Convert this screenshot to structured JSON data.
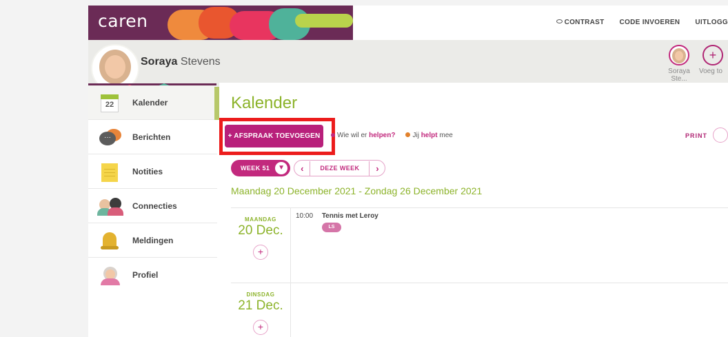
{
  "brand": {
    "name": "caren"
  },
  "top_links": {
    "contrast": "CONTRAST",
    "code": "CODE INVOEREN",
    "logout": "UITLOGG"
  },
  "user": {
    "first_name": "Soraya",
    "last_name": "Stevens"
  },
  "profiles": [
    {
      "label": "Soraya Ste..."
    },
    {
      "label": "Voeg to"
    }
  ],
  "sidebar": {
    "items": [
      {
        "label": "Kalender",
        "icon": "calendar-icon",
        "badge": "22"
      },
      {
        "label": "Berichten",
        "icon": "chat-icon"
      },
      {
        "label": "Notities",
        "icon": "notes-icon"
      },
      {
        "label": "Connecties",
        "icon": "people-icon"
      },
      {
        "label": "Meldingen",
        "icon": "bell-icon"
      },
      {
        "label": "Profiel",
        "icon": "profile-icon"
      }
    ]
  },
  "main": {
    "title": "Kalender",
    "add_button": "+ AFSPRAAK TOEVOEGEN",
    "help_wanted_prefix": "Wie wil er",
    "help_wanted_highlight": "helpen?",
    "i_help_prefix": "Jij",
    "i_help_highlight": "helpt",
    "i_help_suffix": "mee",
    "print": "PRINT",
    "week_label": "WEEK 51",
    "this_week": "DEZE WEEK",
    "range": "Maandag 20 December 2021 - Zondag 26 December 2021",
    "days": [
      {
        "name": "MAANDAG",
        "date": "20 Dec.",
        "event": {
          "time": "10:00",
          "title": "Tennis met Leroy",
          "badge": "LS"
        }
      },
      {
        "name": "DINSDAG",
        "date": "21 Dec."
      }
    ]
  },
  "colors": {
    "brand": "#6b2b56",
    "accent": "#c2297d",
    "green": "#8cb32a",
    "highlight": "#ec1c1c"
  }
}
